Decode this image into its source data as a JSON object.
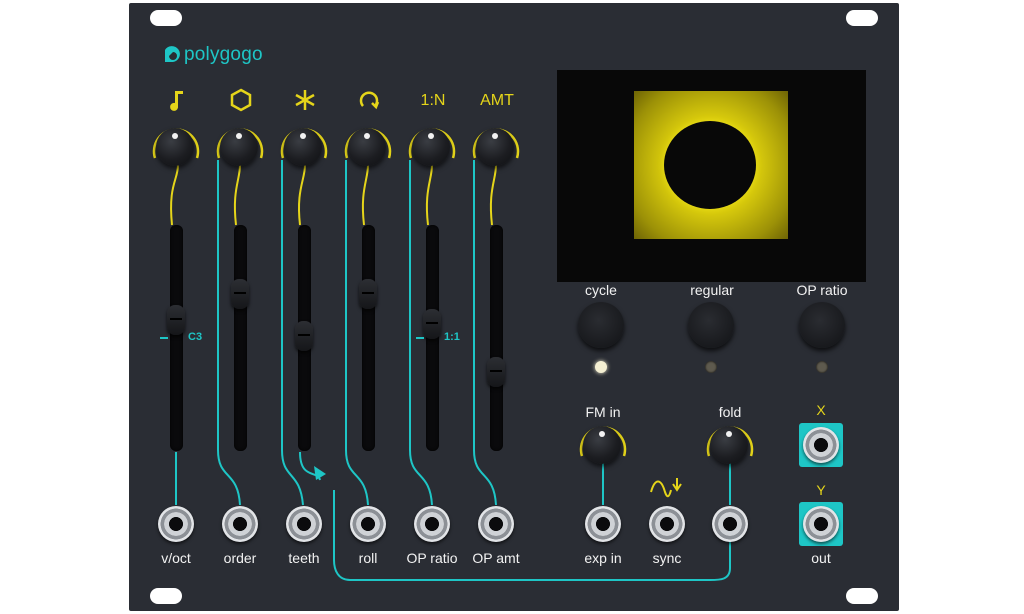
{
  "brand": {
    "name": "polygogo"
  },
  "top_symbols": {
    "s1": "note-icon",
    "s2": "hexagon-icon",
    "s3": "asterisk-icon",
    "s4": "rotate-icon",
    "s5": "1:N",
    "s6": "AMT"
  },
  "slider_marks": {
    "c3": "C3",
    "ratio": "1:1"
  },
  "jack_labels": [
    "v/oct",
    "order",
    "teeth",
    "roll",
    "OP ratio",
    "OP amt",
    "exp in",
    "sync",
    "out"
  ],
  "buttons": {
    "cycle": "cycle",
    "regular": "regular",
    "op_ratio": "OP ratio"
  },
  "knob_labels": {
    "fm_in": "FM in",
    "fold": "fold"
  },
  "xy_labels": {
    "x": "X",
    "y": "Y"
  },
  "leds": {
    "cycle": "on",
    "regular": "off",
    "op_ratio": "off"
  },
  "colors": {
    "panel": "#2a2d34",
    "accent_teal": "#1ec6c6",
    "accent_yellow": "#e5d51a"
  }
}
